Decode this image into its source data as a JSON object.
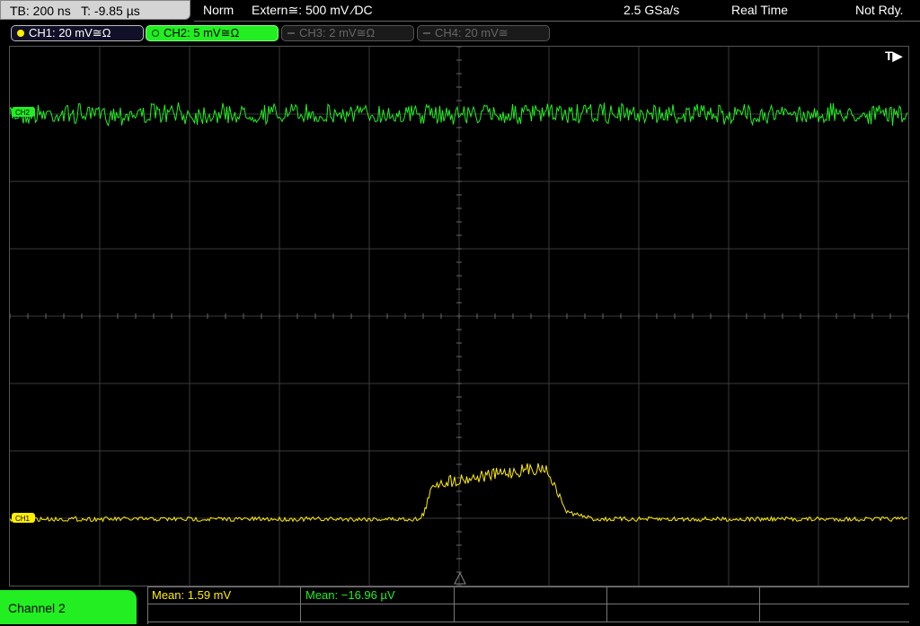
{
  "status": {
    "tb": "TB: 200 ns",
    "t": "T: -9.85 µs",
    "mode": "Norm",
    "trigger": "Extern≅: 500 mV ⁄DC",
    "sample_rate": "2.5 GSa/s",
    "acq": "Real Time",
    "state": "Not Rdy."
  },
  "channels": [
    {
      "label": "CH1: 20 mV≅Ω",
      "color": "#ffee00"
    },
    {
      "label": "CH2: 5 mV≅Ω",
      "color": "#22ee22"
    },
    {
      "label": "CH3: 2 mV≅Ω",
      "color": "#555555"
    },
    {
      "label": "CH4: 20 mV≅",
      "color": "#555555"
    }
  ],
  "trigger_marker": "T▶",
  "ch1_marker": "CH1",
  "ch2_marker": "CH2",
  "bottom": {
    "channel_label": "Channel 2",
    "mean1": "Mean: 1.59 mV",
    "mean2": "Mean: −16.96 µV"
  },
  "colors": {
    "ch1": "#ffee00",
    "ch2": "#22ee22",
    "grid": "#3a3a3a"
  }
}
